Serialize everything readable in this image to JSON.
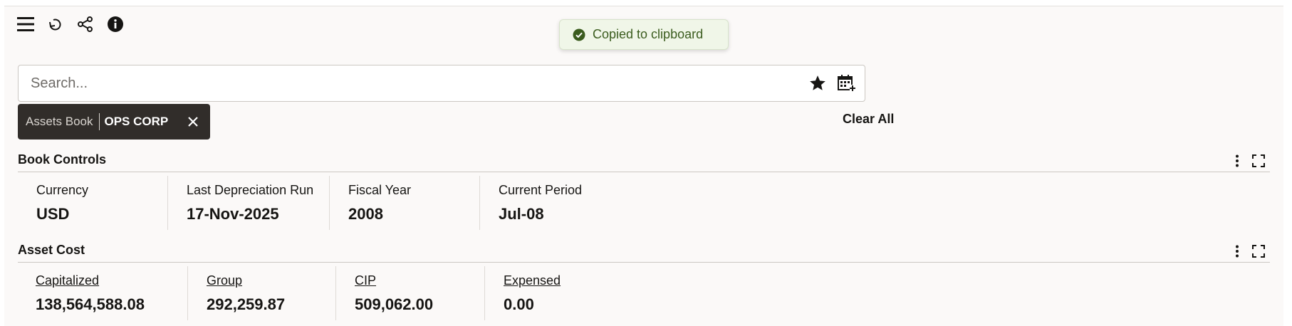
{
  "toolbar": {
    "icons": [
      "menu-icon",
      "undo-icon",
      "share-icon",
      "info-icon"
    ]
  },
  "toast": {
    "message": "Copied to clipboard",
    "color": "#3b5c1e"
  },
  "search": {
    "placeholder": "Search..."
  },
  "filter_chip": {
    "label": "Assets Book",
    "value": "OPS CORP"
  },
  "clear_all": "Clear All",
  "book_controls": {
    "title": "Book Controls",
    "metrics": [
      {
        "label": "Currency",
        "value": "USD"
      },
      {
        "label": "Last Depreciation Run",
        "value": "17-Nov-2025"
      },
      {
        "label": "Fiscal Year",
        "value": "2008"
      },
      {
        "label": "Current Period",
        "value": "Jul-08"
      }
    ]
  },
  "asset_cost": {
    "title": "Asset Cost",
    "metrics": [
      {
        "label": "Capitalized",
        "value": "138,564,588.08"
      },
      {
        "label": "Group",
        "value": "292,259.87"
      },
      {
        "label": "CIP",
        "value": "509,062.00"
      },
      {
        "label": "Expensed",
        "value": "0.00"
      }
    ]
  }
}
